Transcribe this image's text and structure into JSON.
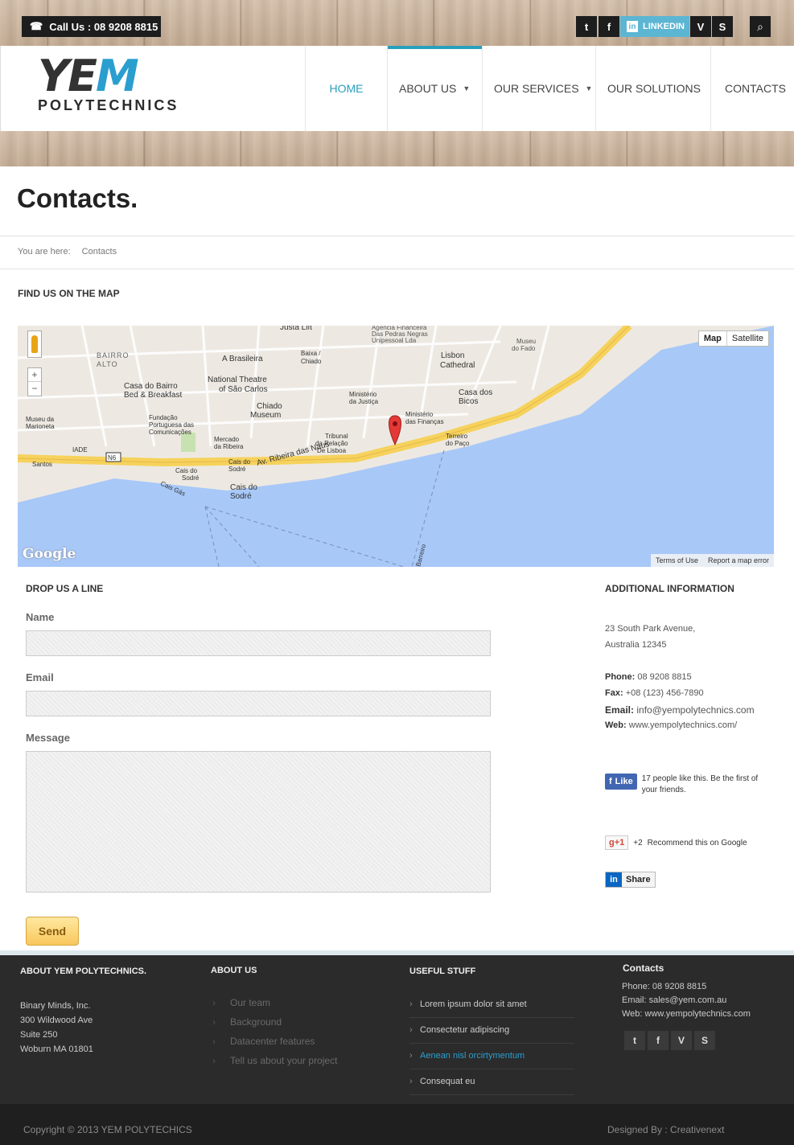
{
  "topbar": {
    "call_label": "Call Us : 08 9208 8815",
    "social": [
      {
        "icon": "twitter-icon",
        "glyph": "t"
      },
      {
        "icon": "facebook-icon",
        "glyph": "f"
      }
    ],
    "linkedin_glyph": "in",
    "linkedin_label": "LINKEDIN",
    "social_right": [
      {
        "icon": "vimeo-icon",
        "glyph": "V"
      },
      {
        "icon": "skype-icon",
        "glyph": "S"
      }
    ],
    "search_glyph": "⌕"
  },
  "header": {
    "logo_word_1": "YE",
    "logo_word_2": "M",
    "logo_sub": "POLYTECHNICS",
    "nav": [
      {
        "label": "HOME",
        "has_dropdown": false
      },
      {
        "label": "ABOUT US",
        "has_dropdown": true
      },
      {
        "label": "OUR SERVICES",
        "has_dropdown": true
      },
      {
        "label": "OUR SOLUTIONS",
        "has_dropdown": false
      },
      {
        "label": "CONTACTS",
        "has_dropdown": false
      }
    ],
    "chevron": "▼"
  },
  "page": {
    "title": "Contacts.",
    "breadcrumb_prefix": "You are here:",
    "breadcrumb_current": "Contacts",
    "map_heading": "FIND US ON THE MAP"
  },
  "map": {
    "btn_map": "Map",
    "btn_satellite": "Satellite",
    "terms": "Terms of Use",
    "report": "Report a map error",
    "google": "Google",
    "zoom_in": "+",
    "zoom_out": "−",
    "labels": [
      "Justa Lift",
      "Agência Financeira Das Pedras Negras Unipessoal Lda",
      "Museu do Fado",
      "BAIRRO ALTO",
      "A Brasileira",
      "Baixa / Chiado",
      "Lisbon Cathedral",
      "Casa do Bairro Bed & Breakfast",
      "National Theatre of São Carlos",
      "Casa dos Bicos",
      "Ministério da Justiça",
      "Chiado Museum",
      "Ministério das Finanças",
      "Museu da Marioneta",
      "Fundação Portuguesa das Comunicações",
      "Terreiro do Paço",
      "Mercado da Ribeira",
      "Tribunal da Relação De Lisboa",
      "IADE",
      "N6",
      "Santos",
      "Cais do Sodré",
      "Av. Ribeira das Naus",
      "Cais do Sodré",
      "Cais Gás",
      "Barreiro"
    ]
  },
  "form": {
    "heading": "DROP US A LINE",
    "name_label": "Name",
    "email_label": "Email",
    "message_label": "Message",
    "send_label": "Send"
  },
  "info": {
    "heading": "ADDITIONAL INFORMATION",
    "address_1": "23 South Park Avenue,",
    "address_2": "Australia 12345",
    "phone_label": "Phone:",
    "phone": "08 9208 8815",
    "fax_label": "Fax:",
    "fax": "+08 (123) 456-7890",
    "email_label": "Email:",
    "email": "info@yempolytechnics.com",
    "web_label": "Web:",
    "web": "www.yempolytechnics.com/",
    "fb_like": "Like",
    "fb_text": "17 people like this. Be the first of your friends.",
    "gplus_btn": "g+1",
    "gplus_count": "+2",
    "gplus_text": "Recommend this on Google",
    "li_in": "in",
    "li_share": "Share"
  },
  "footer": {
    "about_title": "ABOUT YEM POLYTECHNICS.",
    "about_lines": [
      "Binary Minds, Inc.",
      "300 Wildwood Ave",
      "Suite 250",
      "Woburn MA 01801"
    ],
    "aboutus_title": "ABOUT US",
    "aboutus_links": [
      "Our team",
      "Background",
      "Datacenter features",
      "Tell us about your project"
    ],
    "useful_title": "USEFUL STUFF",
    "useful_links": [
      "Lorem ipsum dolor sit amet",
      "Consectetur adipiscing",
      "Aenean nisl orcirtymentum",
      "Consequat eu"
    ],
    "contacts_title": "Contacts",
    "contacts_phone": "Phone: 08 9208 8815",
    "contacts_email": "Email: sales@yem.com.au",
    "contacts_web": "Web: www.yempolytechnics.com",
    "social": [
      {
        "icon": "twitter-icon",
        "glyph": "t"
      },
      {
        "icon": "facebook-icon",
        "glyph": "f"
      },
      {
        "icon": "vimeo-icon",
        "glyph": "V"
      },
      {
        "icon": "skype-icon",
        "glyph": "S"
      }
    ],
    "copyright": "Copyright © 2013 YEM POLYTECHICS",
    "designed": "Designed By :  Creativenext"
  },
  "colors": {
    "accent": "#2a9fbd",
    "link_highlight": "#2a9fcf",
    "linkedin": "#5cb5d3",
    "footer_bg": "#2b2b2b"
  }
}
